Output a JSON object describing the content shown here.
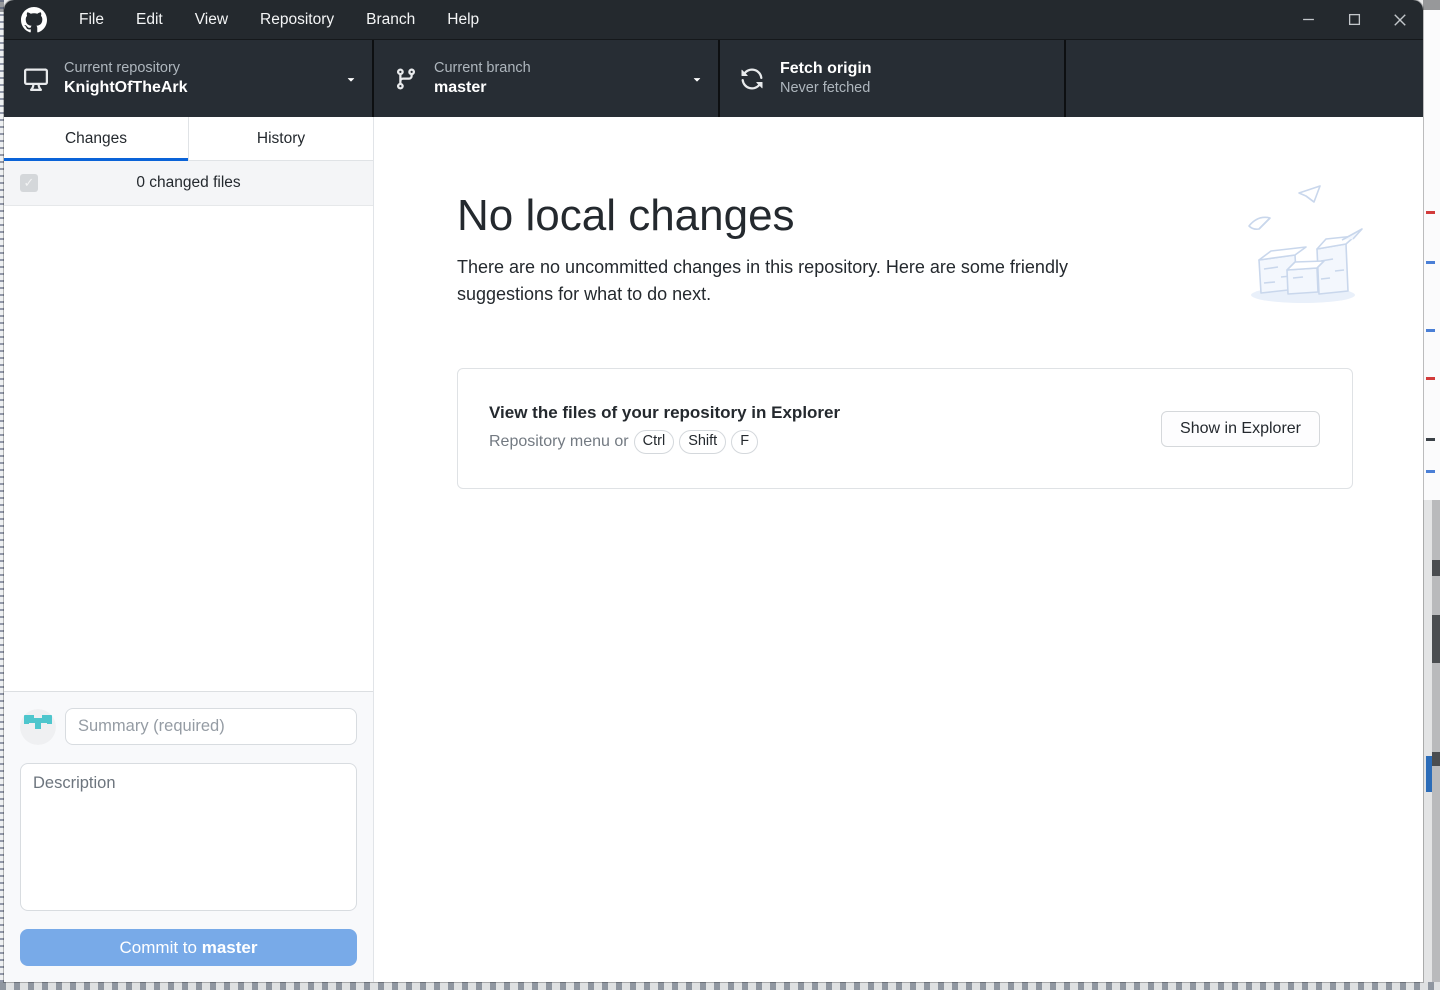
{
  "window": {
    "menu": [
      "File",
      "Edit",
      "View",
      "Repository",
      "Branch",
      "Help"
    ]
  },
  "toolbar": {
    "repository": {
      "label": "Current repository",
      "value": "KnightOfTheArk"
    },
    "branch": {
      "label": "Current branch",
      "value": "master"
    },
    "fetch": {
      "title": "Fetch origin",
      "subtitle": "Never fetched"
    }
  },
  "sidebar": {
    "tabs": [
      {
        "label": "Changes",
        "active": true
      },
      {
        "label": "History",
        "active": false
      }
    ],
    "changes_summary": "0 changed files",
    "checkbox_glyph": "✓",
    "commit_form": {
      "summary_placeholder": "Summary (required)",
      "description_placeholder": "Description",
      "commit_button_prefix": "Commit to ",
      "commit_button_branch": "master"
    }
  },
  "main": {
    "title": "No local changes",
    "subtitle": "There are no uncommitted changes in this repository. Here are some friendly suggestions for what to do next.",
    "card": {
      "title": "View the files of your repository in Explorer",
      "hint_prefix": "Repository menu or",
      "shortcut_keys": [
        "Ctrl",
        "Shift",
        "F"
      ],
      "button_label": "Show in Explorer"
    }
  },
  "colors": {
    "titlebar": "#24292e",
    "toolbar": "#272d34",
    "active_tab_underline": "#0a63d8",
    "commit_button": "#78aae8",
    "identicon_teal": "#4ec6cd",
    "illustration_stroke": "#c9d7ec"
  }
}
